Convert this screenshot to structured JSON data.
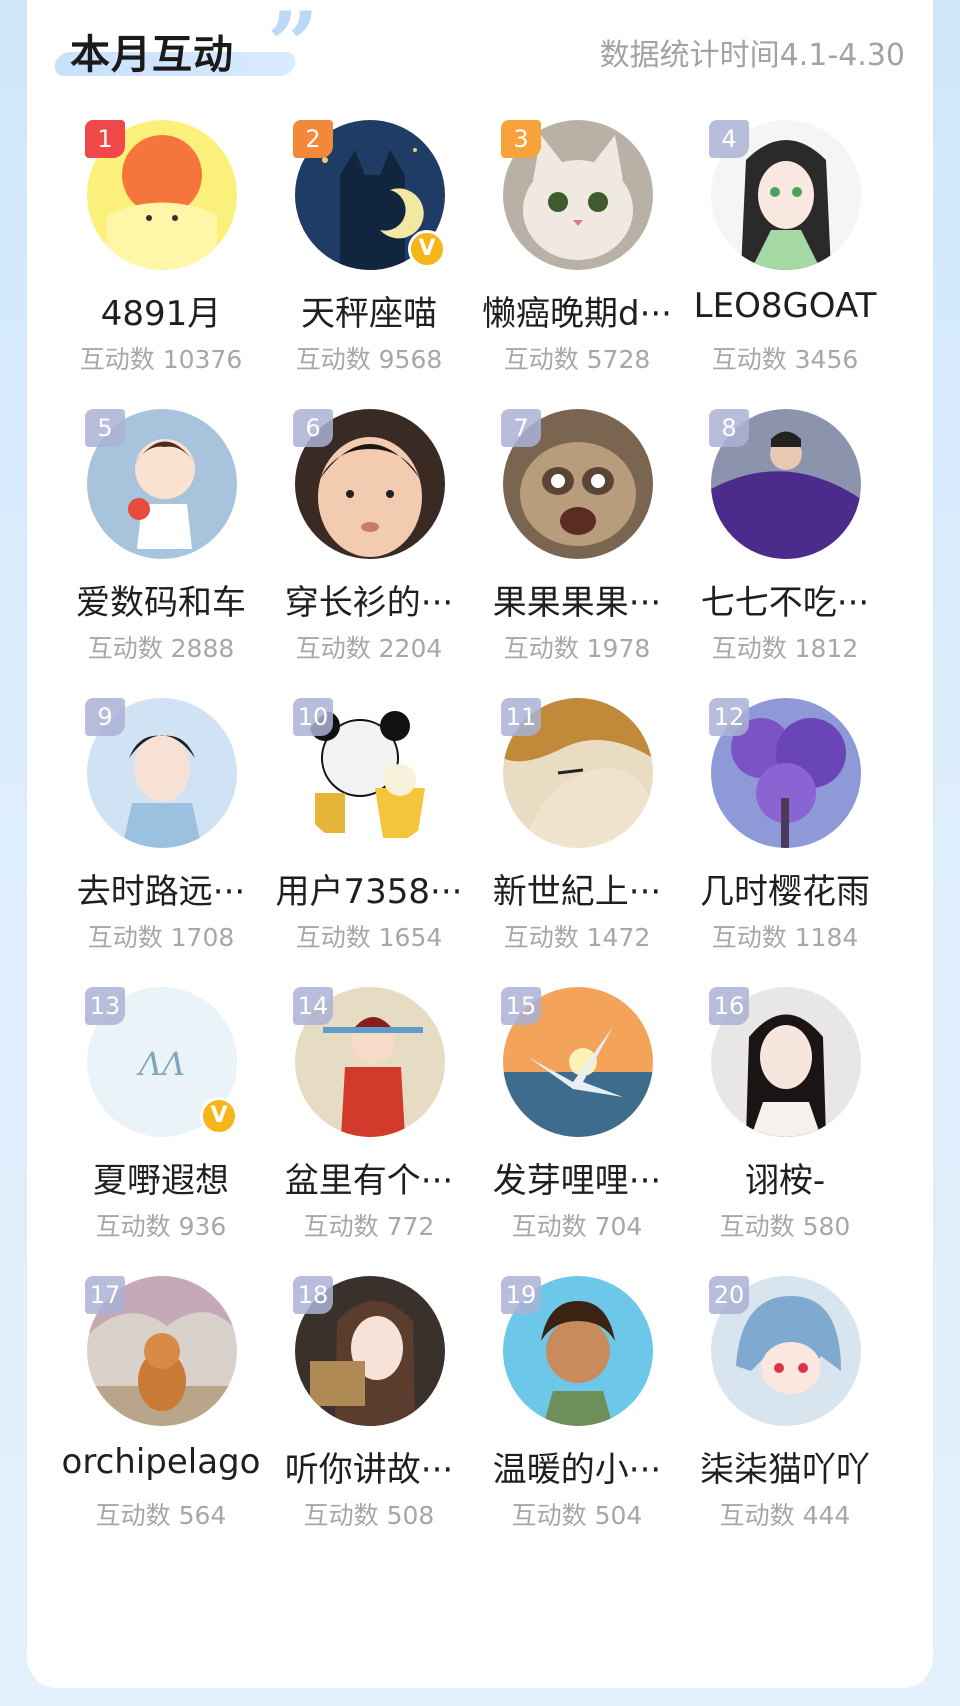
{
  "header": {
    "title": "本月互动",
    "subtitle": "数据统计时间4.1-4.30"
  },
  "users": [
    {
      "rank": "1",
      "name": "4891月",
      "count": "互动数 10376",
      "verified": false,
      "avatar": "sun-pudding-avatar"
    },
    {
      "rank": "2",
      "name": "天秤座喵",
      "count": "互动数 9568",
      "verified": true,
      "avatar": "night-cat-avatar"
    },
    {
      "rank": "3",
      "name": "懒癌晚期d···",
      "count": "互动数 5728",
      "verified": false,
      "avatar": "kitten-avatar"
    },
    {
      "rank": "4",
      "name": "LEO8GOAT",
      "count": "互动数 3456",
      "verified": false,
      "avatar": "anime-girl-avatar"
    },
    {
      "rank": "5",
      "name": "爱数码和车",
      "count": "互动数 2888",
      "verified": false,
      "avatar": "cartoon-boy-avatar"
    },
    {
      "rank": "6",
      "name": "穿长衫的···",
      "count": "互动数 2204",
      "verified": false,
      "avatar": "baby-face-avatar"
    },
    {
      "rank": "7",
      "name": "果果果果···",
      "count": "互动数 1978",
      "verified": false,
      "avatar": "sloth-avatar"
    },
    {
      "rank": "8",
      "name": "七七不吃···",
      "count": "互动数 1812",
      "verified": false,
      "avatar": "purple-flag-avatar"
    },
    {
      "rank": "9",
      "name": "去时路远···",
      "count": "互动数 1708",
      "verified": false,
      "avatar": "painted-boy-avatar"
    },
    {
      "rank": "10",
      "name": "用户7358···",
      "count": "互动数 1654",
      "verified": false,
      "avatar": "panda-meme-avatar"
    },
    {
      "rank": "11",
      "name": "新世紀上···",
      "count": "互动数 1472",
      "verified": false,
      "avatar": "manga-face-avatar"
    },
    {
      "rank": "12",
      "name": "几时樱花雨",
      "count": "互动数 1184",
      "verified": false,
      "avatar": "purple-tree-avatar"
    },
    {
      "rank": "13",
      "name": "夏嘢遐想",
      "count": "互动数 936",
      "verified": true,
      "avatar": "script-logo-avatar"
    },
    {
      "rank": "14",
      "name": "盆里有个···",
      "count": "互动数 772",
      "verified": false,
      "avatar": "opera-figure-avatar"
    },
    {
      "rank": "15",
      "name": "发芽哩哩···",
      "count": "互动数 704",
      "verified": false,
      "avatar": "seagull-sunset-avatar"
    },
    {
      "rank": "16",
      "name": "诩桉-",
      "count": "互动数 580",
      "verified": false,
      "avatar": "girl-portrait-avatar"
    },
    {
      "rank": "17",
      "name": "orchipelago",
      "count": "互动数 564",
      "verified": false,
      "avatar": "shiba-dog-avatar"
    },
    {
      "rank": "18",
      "name": "听你讲故···",
      "count": "互动数 508",
      "verified": false,
      "avatar": "woman-selfie-avatar"
    },
    {
      "rank": "19",
      "name": "温暖的小···",
      "count": "互动数 504",
      "verified": false,
      "avatar": "curly-boy-avatar"
    },
    {
      "rank": "20",
      "name": "柒柒猫吖吖",
      "count": "互动数 444",
      "verified": false,
      "avatar": "blue-hair-anime-avatar"
    }
  ],
  "verified_badge": "V",
  "colors": {
    "rank1": "#f04848",
    "rank2": "#f4883a",
    "rank3": "#f7a23a",
    "rank_default": "#aab2d4",
    "verified": "#f6b617",
    "accent": "#c7e1fb"
  }
}
